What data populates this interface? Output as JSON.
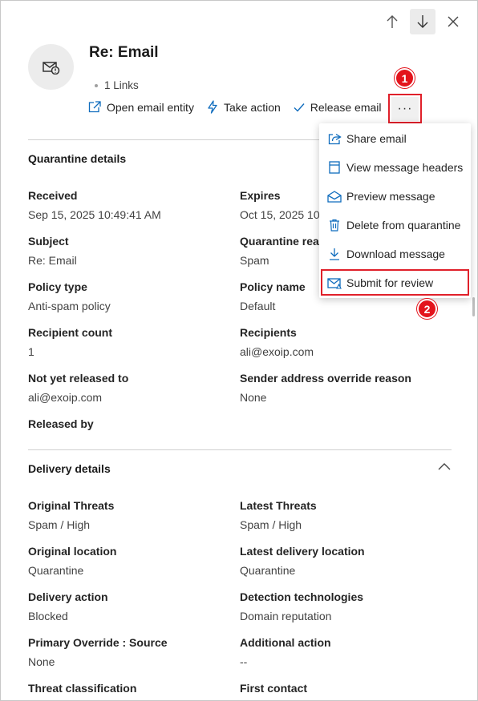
{
  "header": {
    "title": "Re: Email",
    "links_text": "1 Links"
  },
  "actions": {
    "open_email_entity": "Open email entity",
    "take_action": "Take action",
    "release_email": "Release email",
    "more": "···"
  },
  "annotations": {
    "badge1": "1",
    "badge2": "2"
  },
  "menu": {
    "items": [
      {
        "label": "Share email",
        "icon": "share-icon"
      },
      {
        "label": "View message headers",
        "icon": "headers-icon"
      },
      {
        "label": "Preview message",
        "icon": "envelope-open-icon"
      },
      {
        "label": "Delete from quarantine",
        "icon": "trash-icon"
      },
      {
        "label": "Download message",
        "icon": "download-icon"
      },
      {
        "label": "Submit for review",
        "icon": "submit-icon"
      }
    ]
  },
  "quarantine": {
    "title": "Quarantine details",
    "received_label": "Received",
    "received_value": "Sep 15, 2025 10:49:41 AM",
    "expires_label": "Expires",
    "expires_value": "Oct 15, 2025 10",
    "subject_label": "Subject",
    "subject_value": "Re: Email",
    "reason_label": "Quarantine reas",
    "reason_value": "Spam",
    "policy_type_label": "Policy type",
    "policy_type_value": "Anti-spam policy",
    "policy_name_label": "Policy name",
    "policy_name_value": "Default",
    "recipient_count_label": "Recipient count",
    "recipient_count_value": "1",
    "recipients_label": "Recipients",
    "recipients_value": "ali@exoip.com",
    "not_released_label": "Not yet released to",
    "not_released_value": "ali@exoip.com",
    "override_reason_label": "Sender address override reason",
    "override_reason_value": "None",
    "released_by_label": "Released by"
  },
  "delivery": {
    "title": "Delivery details",
    "original_threats_label": "Original Threats",
    "original_threats_value": "Spam / High",
    "latest_threats_label": "Latest Threats",
    "latest_threats_value": "Spam / High",
    "original_location_label": "Original location",
    "original_location_value": "Quarantine",
    "latest_location_label": "Latest delivery location",
    "latest_location_value": "Quarantine",
    "delivery_action_label": "Delivery action",
    "delivery_action_value": "Blocked",
    "detection_label": "Detection technologies",
    "detection_value": "Domain reputation",
    "primary_override_label": "Primary Override : Source",
    "primary_override_value": "None",
    "additional_action_label": "Additional action",
    "additional_action_value": "--",
    "threat_class_label": "Threat classification",
    "first_contact_label": "First contact"
  },
  "colors": {
    "accent": "#0f6cbd",
    "annotation_red": "#e3141c"
  }
}
